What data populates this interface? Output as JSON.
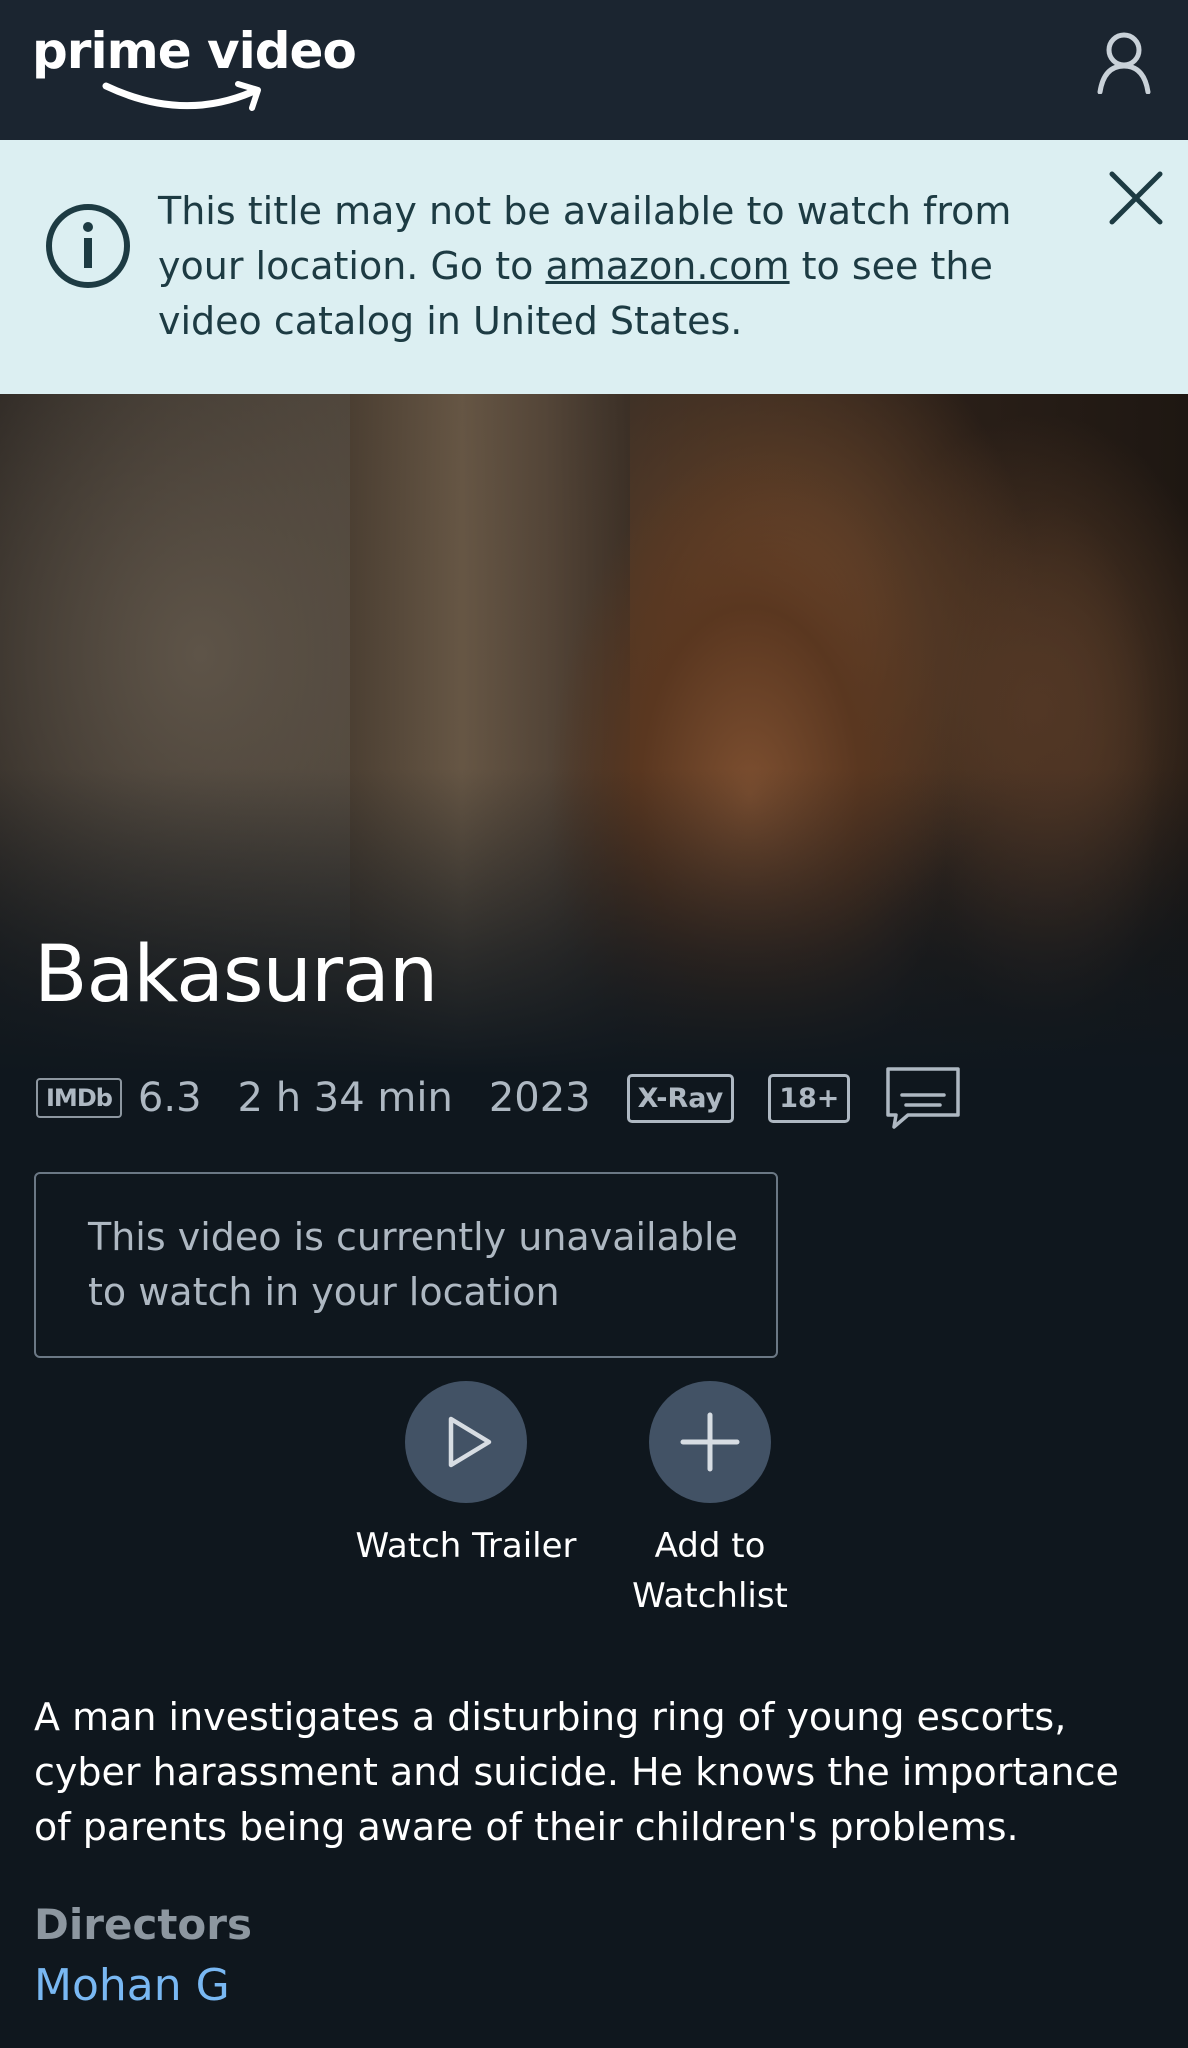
{
  "header": {
    "logo_text": "prime video",
    "profile_icon": "user-icon"
  },
  "notice": {
    "text_before": "This title may not be available to watch from your location. Go to ",
    "link_text": "amazon.com",
    "text_after": " to see the video catalog in United States.",
    "info_icon": "info-icon",
    "close_icon": "close-icon"
  },
  "title": "Bakasuran",
  "meta": {
    "imdb_label": "IMDb",
    "imdb_rating": "6.3",
    "duration": "2 h 34 min",
    "year": "2023",
    "xray_badge": "X-Ray",
    "age_rating": "18+",
    "subtitles_icon": "subtitles-icon"
  },
  "availability_message": "This video is currently unavailable to watch in your location",
  "actions": {
    "watch_trailer": "Watch Trailer",
    "add_to_watchlist": "Add to Watchlist"
  },
  "synopsis": "A man investigates a disturbing ring of young escorts, cyber harassment and suicide. He knows the importance of parents being aware of their children's problems.",
  "directors": {
    "label": "Directors",
    "names": [
      "Mohan G"
    ]
  },
  "colors": {
    "background": "#0f171e",
    "header": "#1b2530",
    "notice_bg": "#dceff2",
    "link_blue": "#79b8f3",
    "action_circle": "#425265"
  }
}
